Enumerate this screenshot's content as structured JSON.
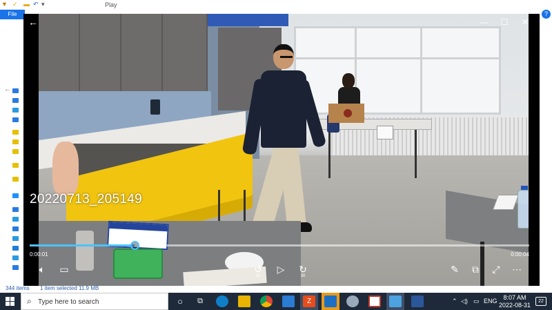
{
  "explorer": {
    "title": "Play",
    "file_tab": "File",
    "help": "?",
    "status": {
      "items": "344 items",
      "selected": "1 item selected  11.9 MB"
    }
  },
  "player": {
    "video_title": "20220713_205149",
    "time_current": "0:00:01",
    "time_total": "0:00:04",
    "progress_fraction": 0.21,
    "skip_back_label": "10",
    "skip_forward_label": "30",
    "accent": "#4cc2ff"
  },
  "taskbar": {
    "search_placeholder": "Type here to search",
    "language": "ENG",
    "time": "8:07 AM",
    "date": "2022-08-31",
    "notifications": "22"
  }
}
